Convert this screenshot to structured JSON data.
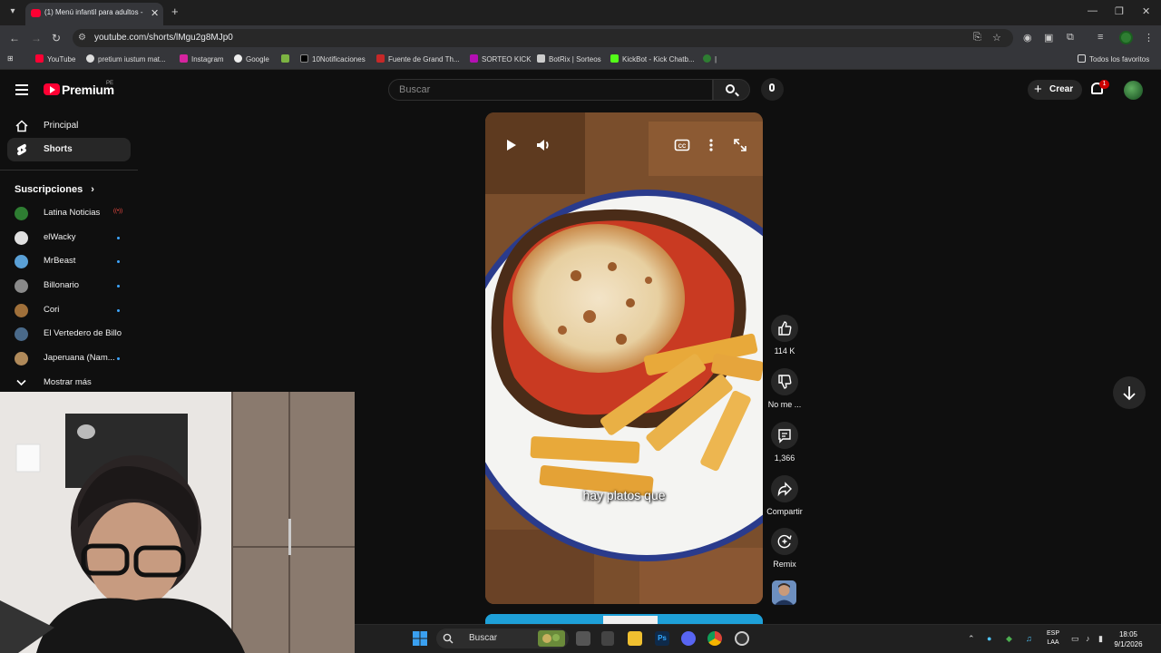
{
  "browser": {
    "tab_title": "(1) Menú infantil para adultos -",
    "url": "youtube.com/shorts/lMgu2g8MJp0",
    "bookmarks": [
      "YouTube",
      "pretium iustum mat...",
      "Instagram",
      "Google",
      "10Notificaciones",
      "Fuente de Grand Th...",
      "SORTEO KICK",
      "BotRix | Sorteos",
      "KickBot - Kick Chatb...",
      "|"
    ],
    "all_bookmarks": "Todos los favoritos"
  },
  "yt": {
    "logo_text": "Premium",
    "logo_sup": "PE",
    "search_placeholder": "Buscar",
    "create_label": "Crear",
    "notif_count": "1"
  },
  "sidebar": {
    "items": [
      {
        "label": "Principal"
      },
      {
        "label": "Shorts"
      }
    ],
    "subs_title": "Suscripciones",
    "subs_chevron": "›",
    "subscriptions": [
      {
        "name": "Latina Noticias",
        "color": "#2e7d32",
        "live": "((•))"
      },
      {
        "name": "elWacky",
        "color": "#e0e0e0"
      },
      {
        "name": "MrBeast",
        "color": "#5aa0d6"
      },
      {
        "name": "Billonario",
        "color": "#8a8a8a"
      },
      {
        "name": "Cori",
        "color": "#a0703a"
      },
      {
        "name": "El Vertedero de Billo",
        "color": "#4a6a8a"
      },
      {
        "name": "Japeruana (Nam...",
        "color": "#b08a5a"
      }
    ],
    "show_more": "Mostrar más"
  },
  "player": {
    "caption": "hay platos que"
  },
  "actions": {
    "likes": "114 K",
    "dislike": "No me ...",
    "comments": "1,366",
    "share": "Compartir",
    "remix": "Remix"
  },
  "taskbar": {
    "search": "Buscar",
    "lang_top": "ESP",
    "lang_bottom": "LAA",
    "time": "18:05",
    "date": "9/1/2026"
  }
}
